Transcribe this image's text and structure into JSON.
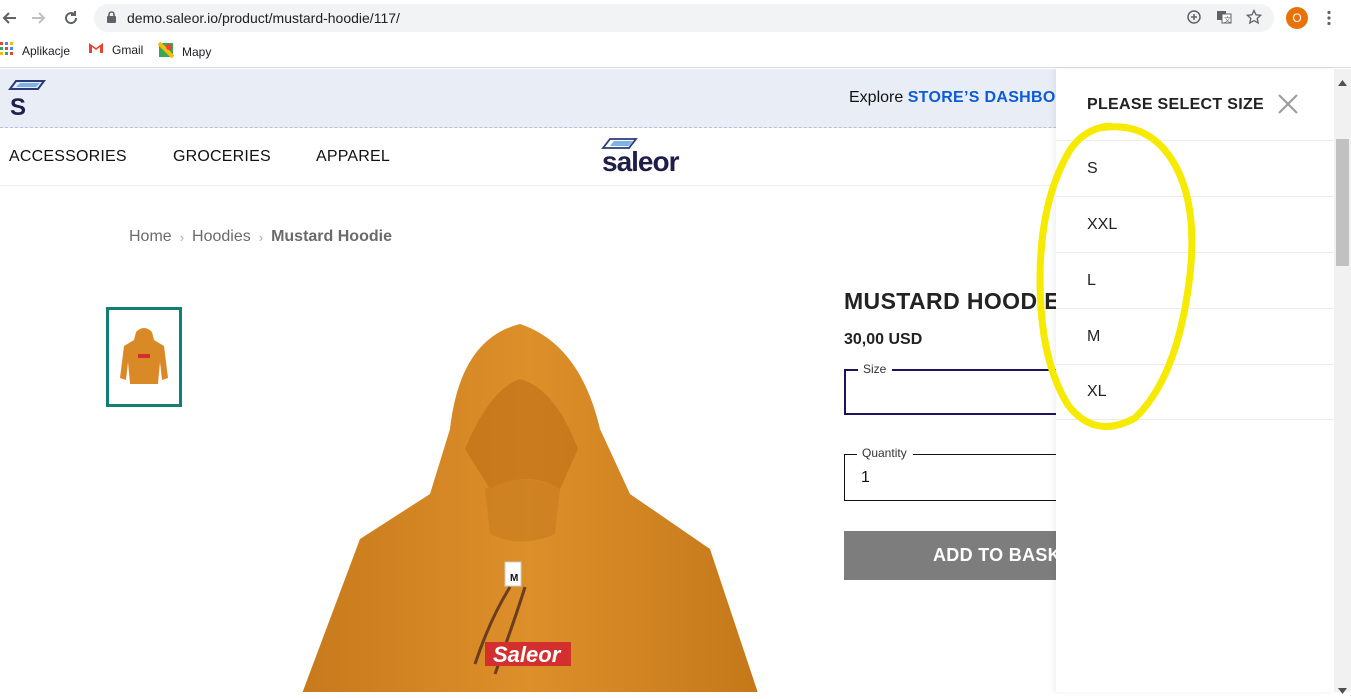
{
  "browser": {
    "url": "demo.saleor.io/product/mustard-hoodie/117/",
    "profile_initial": "O",
    "bookmarks": [
      "Aplikacje",
      "Gmail",
      "Mapy"
    ]
  },
  "banner": {
    "logo_letter": "S",
    "explore_prefix": "Explore",
    "explore_link": "STORE’S DASHBOA"
  },
  "nav": {
    "items": [
      "ACCESSORIES",
      "GROCERIES",
      "APPAREL"
    ],
    "logo_text": "saleor"
  },
  "breadcrumb": {
    "home": "Home",
    "category": "Hoodies",
    "current": "Mustard Hoodie",
    "separator": "›"
  },
  "product": {
    "name": "MUSTARD HOODIE",
    "price": "30,00 USD",
    "size_label": "Size",
    "size_value": "",
    "quantity_label": "Quantity",
    "quantity_value": "1",
    "add_button": "ADD TO BASKET",
    "print_text": "Saleor",
    "tag_text": "M"
  },
  "size_overlay": {
    "title": "PLEASE SELECT SIZE",
    "options": [
      "S",
      "XXL",
      "L",
      "M",
      "XL"
    ]
  },
  "colors": {
    "accent_blue": "#0d5bd6",
    "hoodie": "#d98a26",
    "thumb_border": "#107e76",
    "highlight": "#f5ea00"
  }
}
